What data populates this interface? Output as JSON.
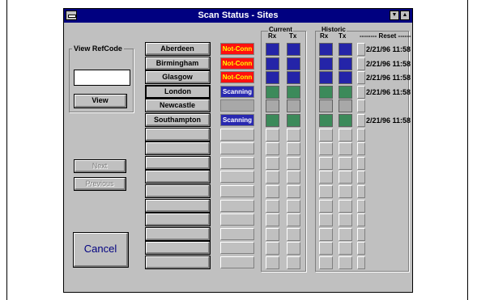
{
  "window": {
    "title": "Scan Status - Sites"
  },
  "view_refcode": {
    "label": "View RefCode",
    "value": "",
    "view_label": "View"
  },
  "nav": {
    "next_label": "Next",
    "previous_label": "Previous"
  },
  "cancel_label": "Cancel",
  "headers": {
    "current": "Current",
    "historic": "Historic",
    "rx": "Rx",
    "tx": "Tx",
    "reset": "-------- Reset --------"
  },
  "sites": [
    {
      "name": "Aberdeen",
      "status": "Not-Conn",
      "cur": "blue",
      "hist": "blue",
      "reset": "2/21/96 11:58"
    },
    {
      "name": "Birmingham",
      "status": "Not-Conn",
      "cur": "blue",
      "hist": "blue",
      "reset": "2/21/96 11:58"
    },
    {
      "name": "Glasgow",
      "status": "Not-Conn",
      "cur": "blue",
      "hist": "blue",
      "reset": "2/21/96 11:58"
    },
    {
      "name": "London",
      "status": "Scanning",
      "cur": "green",
      "hist": "green",
      "reset": "2/21/96 11:58"
    },
    {
      "name": "Newcastle",
      "status": "",
      "cur": "gray",
      "hist": "gray",
      "reset": ""
    },
    {
      "name": "Southampton",
      "status": "Scanning",
      "cur": "green",
      "hist": "green",
      "reset": "2/21/96 11:58"
    }
  ],
  "colors": {
    "blue": "#2424a8",
    "green": "#3c8a5a",
    "gray": "#a8a8a8",
    "notconn_bg": "#ff1010",
    "notconn_fg": "#ffff00",
    "scanning_bg": "#2828b0",
    "scanning_fg": "#ffffff"
  }
}
